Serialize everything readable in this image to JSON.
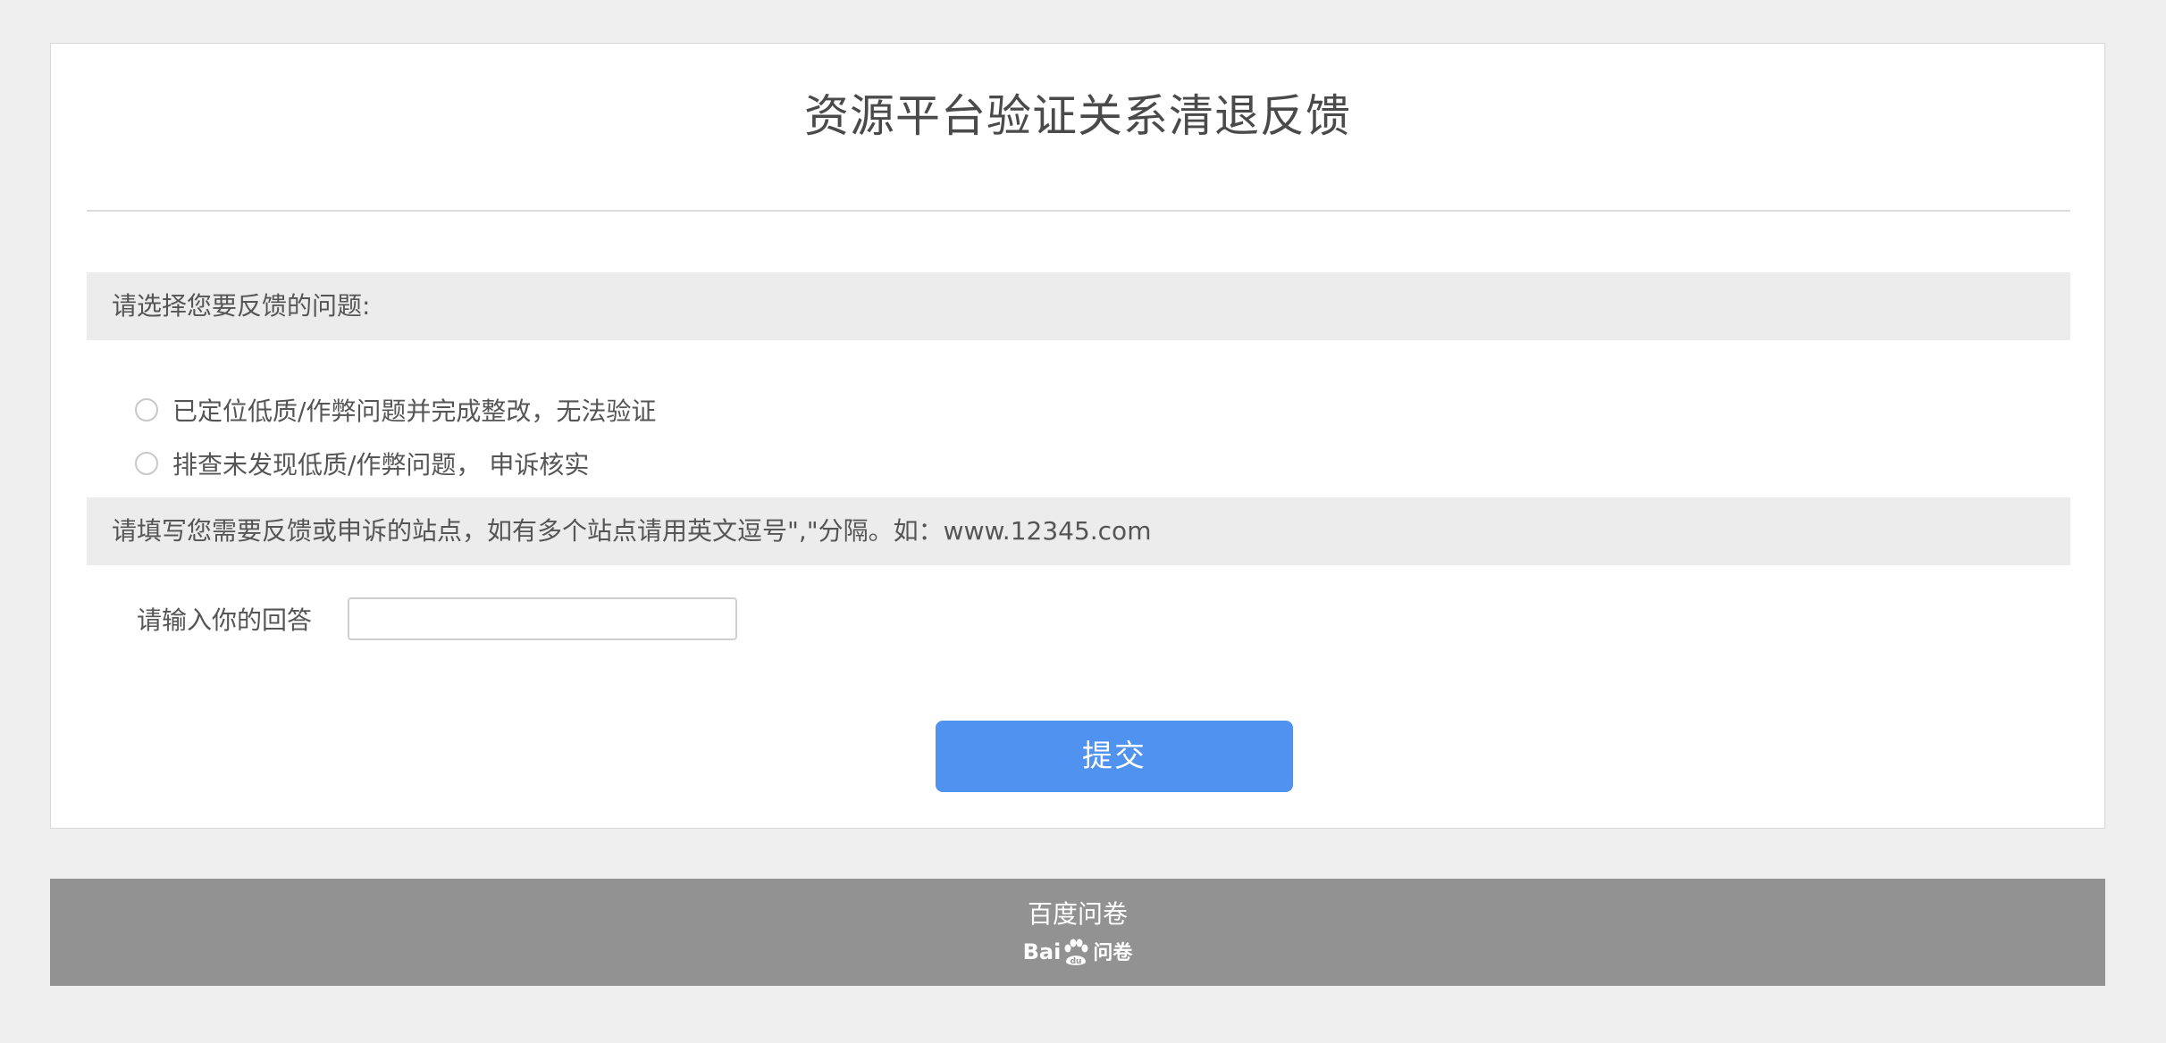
{
  "survey": {
    "title": "资源平台验证关系清退反馈"
  },
  "question1": {
    "header": "请选择您要反馈的问题:",
    "options": [
      {
        "label": "已定位低质/作弊问题并完成整改，无法验证",
        "selected": false
      },
      {
        "label": "排查未发现低质/作弊问题， 申诉核实",
        "selected": false
      }
    ]
  },
  "question2": {
    "header": "请填写您需要反馈或申诉的站点，如有多个站点请用英文逗号\",\"分隔。如：www.12345.com",
    "answer_label": "请输入你的回答",
    "answer_value": ""
  },
  "submit": {
    "label": "提交"
  },
  "footer": {
    "text": "百度问卷",
    "logo_text_left": "Bai",
    "logo_text_paw": "du",
    "logo_text_right": "问卷"
  },
  "colors": {
    "accent": "#5092f0",
    "footer_bg": "#929292",
    "page_bg": "#efefef"
  }
}
